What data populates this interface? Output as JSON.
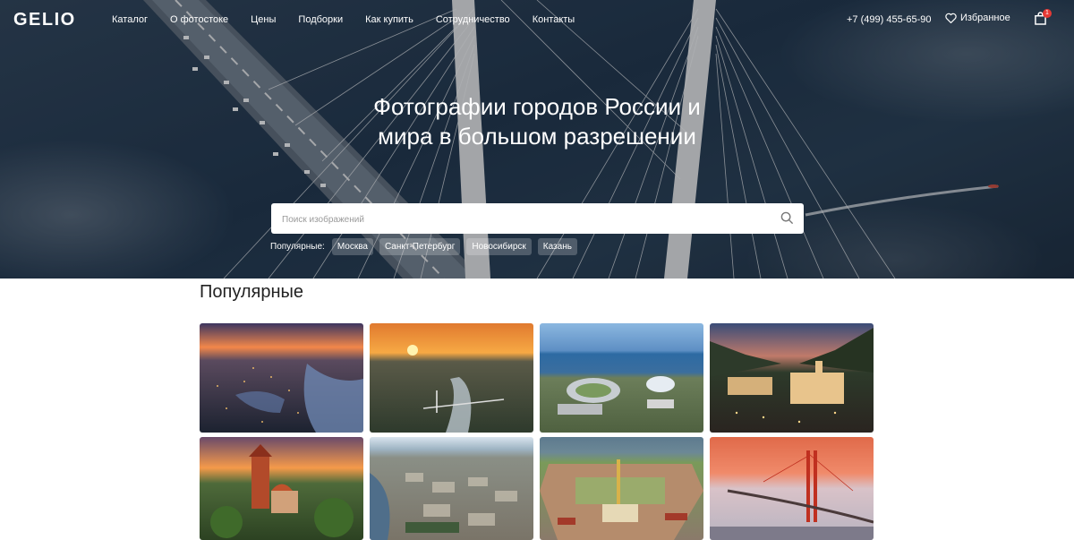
{
  "brand": {
    "logo": "GELIO"
  },
  "nav": {
    "items": [
      "Каталог",
      "О фотостоке",
      "Цены",
      "Подборки",
      "Как купить",
      "Сотрудничество",
      "Контакты"
    ],
    "phone": "+7 (499) 455-65-90",
    "favorites": "Избранное",
    "cart_count": "1"
  },
  "hero": {
    "title": "Фотографии городов России и мира в большом разрешении",
    "search": {
      "placeholder": "Поиск изображений",
      "value": ""
    },
    "popular_label": "Популярные:",
    "popular_tags": [
      "Москва",
      "Санкт-Петербург",
      "Новосибирск",
      "Казань"
    ]
  },
  "section": {
    "title": "Популярные"
  },
  "colors": {
    "accent": "#e53935",
    "text": "#222222"
  }
}
